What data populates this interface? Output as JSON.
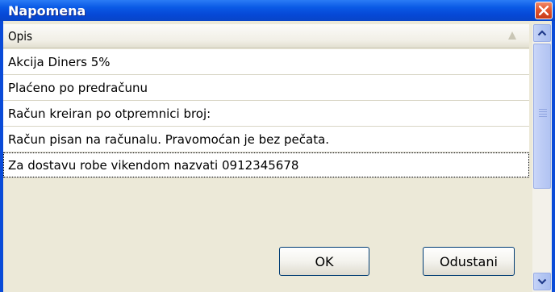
{
  "window": {
    "title": "Napomena"
  },
  "grid": {
    "column_header": "Opis",
    "rows": [
      "Akcija Diners 5%",
      "Plaćeno po predračunu",
      "Račun kreiran po otpremnici broj:",
      "Račun pisan na računalu. Pravomoćan je bez pečata.",
      "Za dostavu robe vikendom nazvati 0912345678"
    ],
    "selected_index": 4
  },
  "buttons": {
    "ok": "OK",
    "cancel": "Odustani"
  },
  "icons": {
    "close": "close-icon",
    "scroll_up": "chevron-up-icon",
    "scroll_down": "chevron-down-icon",
    "sort": "sort-ascending-icon"
  },
  "colors": {
    "titlebar": "#0a5ae6",
    "close_button": "#e2552e",
    "client_background": "#ece9d8",
    "row_background": "#ffffff"
  }
}
